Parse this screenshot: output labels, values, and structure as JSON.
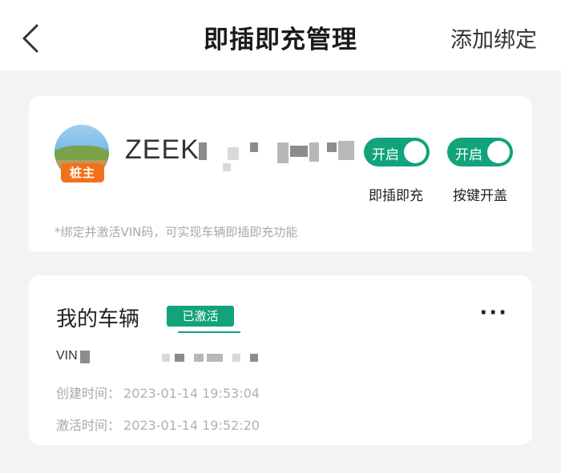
{
  "nav": {
    "back_icon": "chevron-left-icon",
    "title": "即插即充管理",
    "action": "添加绑定"
  },
  "owner_card": {
    "badge": "桩主",
    "plate_prefix": "ZEEK",
    "toggles": [
      {
        "state_text": "开启",
        "label": "即插即充",
        "on": true
      },
      {
        "state_text": "开启",
        "label": "按键开盖",
        "on": true
      }
    ],
    "hint": "*绑定并激活VIN码，可实现车辆即插即充功能"
  },
  "vehicle_card": {
    "title": "我的车辆",
    "status": "已激活",
    "more_icon": "more-horizontal-icon",
    "vin_label": "VIN",
    "created_label": "创建时间：",
    "created_value": "2023-01-14 19:53:04",
    "activated_label": "激活时间：",
    "activated_value": "2023-01-14 19:52:20"
  },
  "colors": {
    "accent_green": "#12a37a",
    "badge_orange": "#f2711c",
    "background": "#f3f3f5"
  }
}
